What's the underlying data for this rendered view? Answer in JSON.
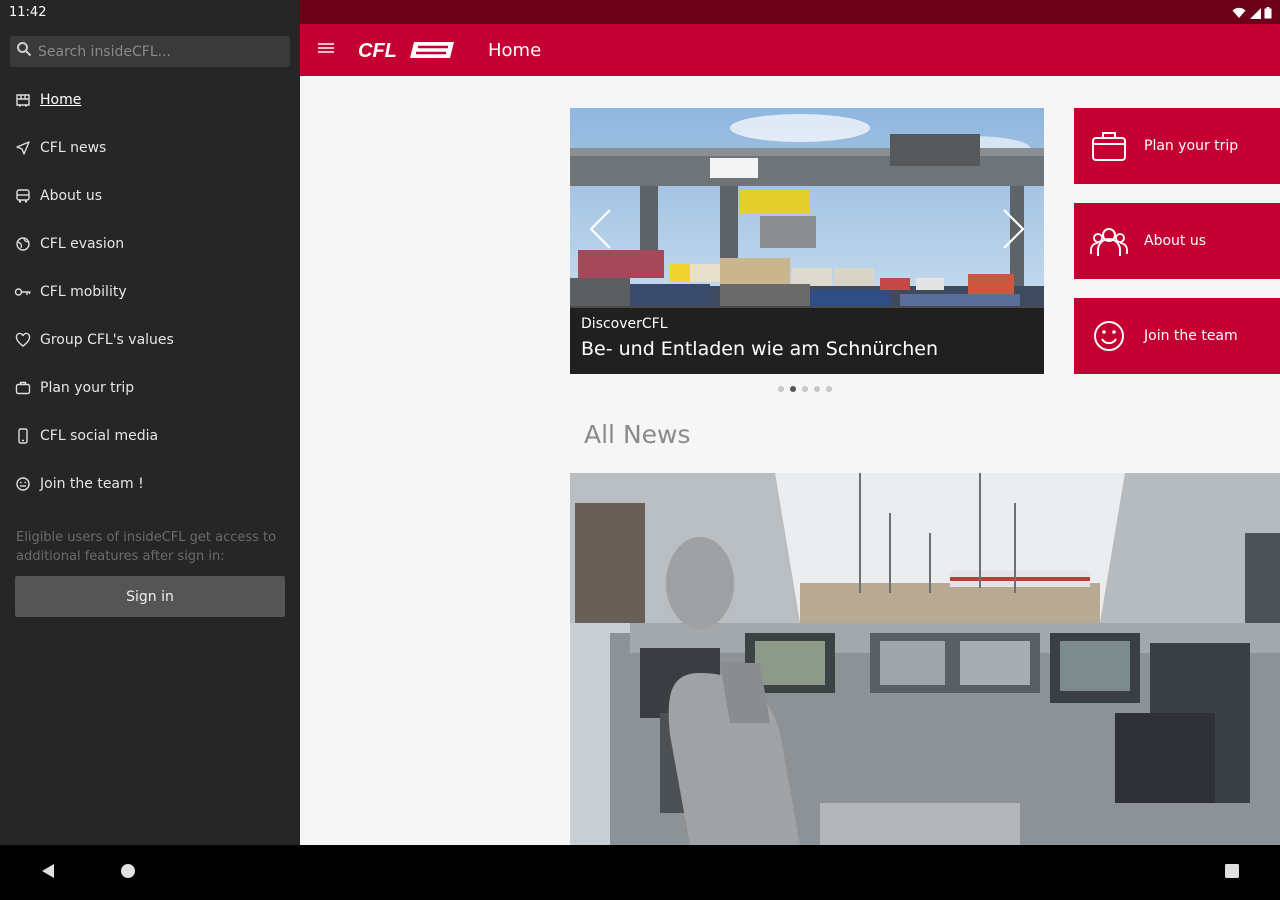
{
  "status": {
    "time": "11:42"
  },
  "drawer": {
    "search_placeholder": "Search insideCFL...",
    "items": [
      {
        "label": "Home",
        "icon": "home-icon"
      },
      {
        "label": "CFL news",
        "icon": "send-icon"
      },
      {
        "label": "About us",
        "icon": "train-icon"
      },
      {
        "label": "CFL evasion",
        "icon": "globe-icon"
      },
      {
        "label": "CFL mobility",
        "icon": "key-icon"
      },
      {
        "label": "Group CFL's values",
        "icon": "heart-icon"
      },
      {
        "label": "Plan your trip",
        "icon": "briefcase-icon"
      },
      {
        "label": "CFL social media",
        "icon": "phone-icon"
      },
      {
        "label": "Join the team !",
        "icon": "smiley-icon"
      }
    ],
    "note": "Eligible users of insideCFL get access to additional features after sign in:",
    "signin_label": "Sign in"
  },
  "appbar": {
    "logo_text": "CFL",
    "title": "Home"
  },
  "carousel": {
    "source": "DiscoverCFL",
    "title": "Be- und Entladen wie am Schnürchen",
    "slide_count": 5,
    "active_index": 1
  },
  "quick_links": [
    {
      "label": "Plan your trip",
      "icon": "briefcase-icon"
    },
    {
      "label": "About us",
      "icon": "team-icon"
    },
    {
      "label": "Join the team",
      "icon": "smiley-icon"
    }
  ],
  "news": {
    "section_title": "All News"
  },
  "colors": {
    "brand_red": "#c30031",
    "status_red": "#6d0019",
    "drawer_bg": "#262626"
  }
}
